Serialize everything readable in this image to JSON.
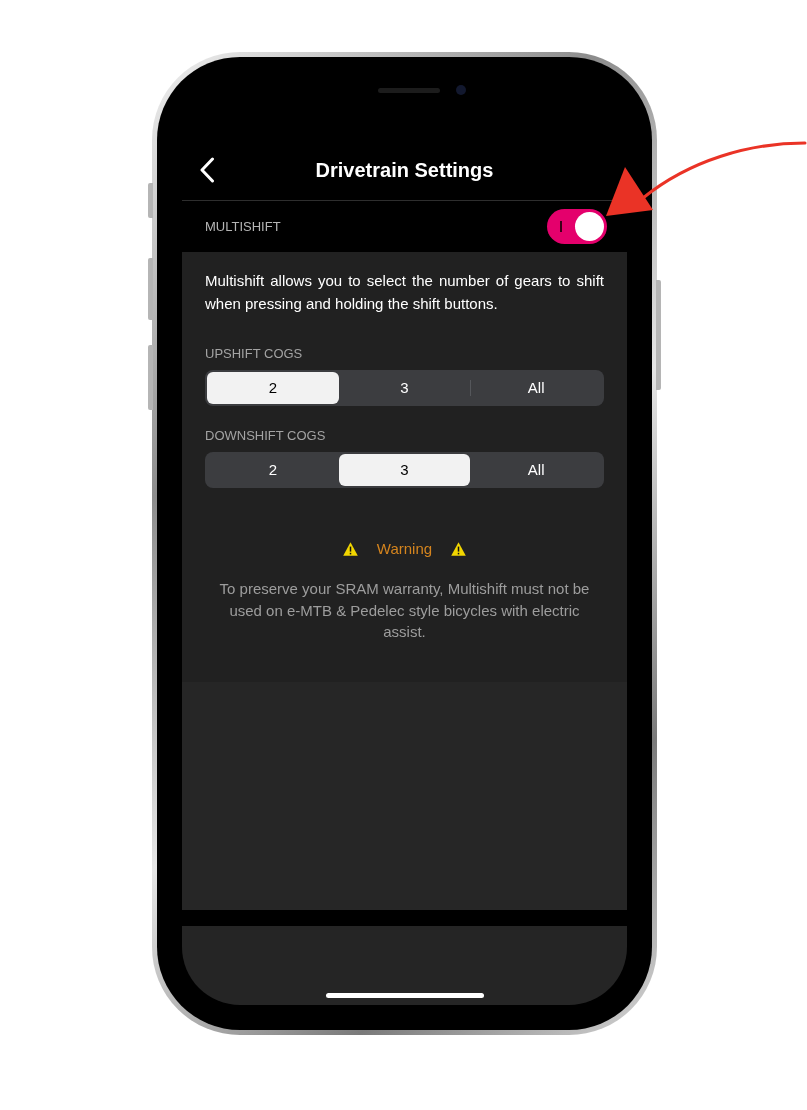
{
  "header": {
    "title": "Drivetrain Settings"
  },
  "multishift": {
    "label": "MULTISHIFT",
    "on": true
  },
  "description": "Multishift allows you to select the number of gears to shift when pressing and holding the shift buttons.",
  "cog_groups": [
    {
      "label": "UPSHIFT COGS",
      "options": [
        {
          "label": "2",
          "selected": true
        },
        {
          "label": "3",
          "selected": false
        },
        {
          "label": "All",
          "selected": false
        }
      ]
    },
    {
      "label": "DOWNSHIFT COGS",
      "options": [
        {
          "label": "2",
          "selected": false
        },
        {
          "label": "3",
          "selected": true
        },
        {
          "label": "All",
          "selected": false
        }
      ]
    }
  ],
  "warning": {
    "title": "Warning",
    "text": "To preserve your SRAM warranty, Multishift must not be used on e-MTB & Pedelec style bicycles with electric assist."
  }
}
